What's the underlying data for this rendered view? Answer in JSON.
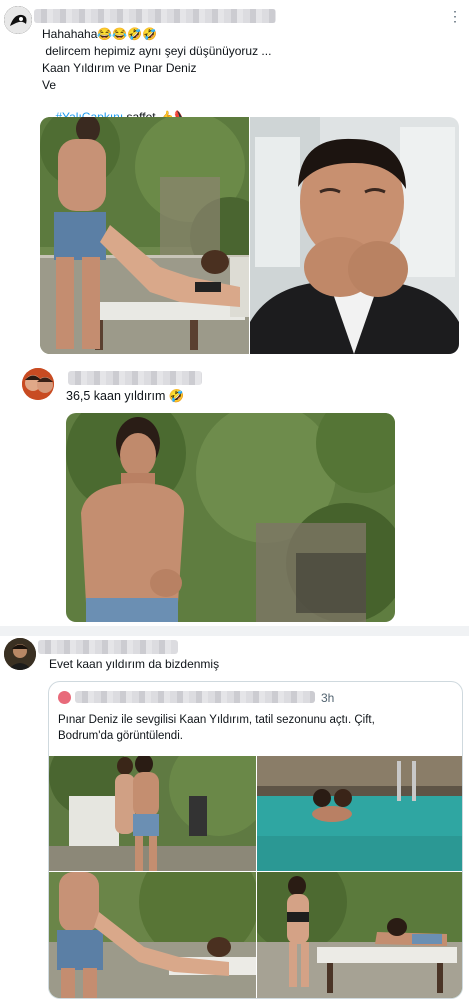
{
  "tweet1": {
    "lines": [
      "Hahahaha😂😂🤣🤣",
      " delircem hepimiz aynı şeyi düşünüyoruz ...",
      "Kaan Yıldırım ve Pınar Deniz",
      "Ve"
    ],
    "hashtag": "#YalıÇapkını",
    "tail": " saffet 👍👠",
    "more_label": "⋮"
  },
  "tweet2": {
    "text": "36,5 kaan yıldırım 🤣"
  },
  "tweet3": {
    "text": "Evet kaan yıldırım da bizdenmiş",
    "quote": {
      "time": "3h",
      "text": "Pınar Deniz ile sevgilisi Kaan Yıldırım, tatil sezonunu açtı. Çift, Bodrum'da görüntülendi."
    }
  },
  "colors": {
    "link": "#1d9bf0",
    "divider": "#f0f2f4",
    "muted": "#536471"
  }
}
